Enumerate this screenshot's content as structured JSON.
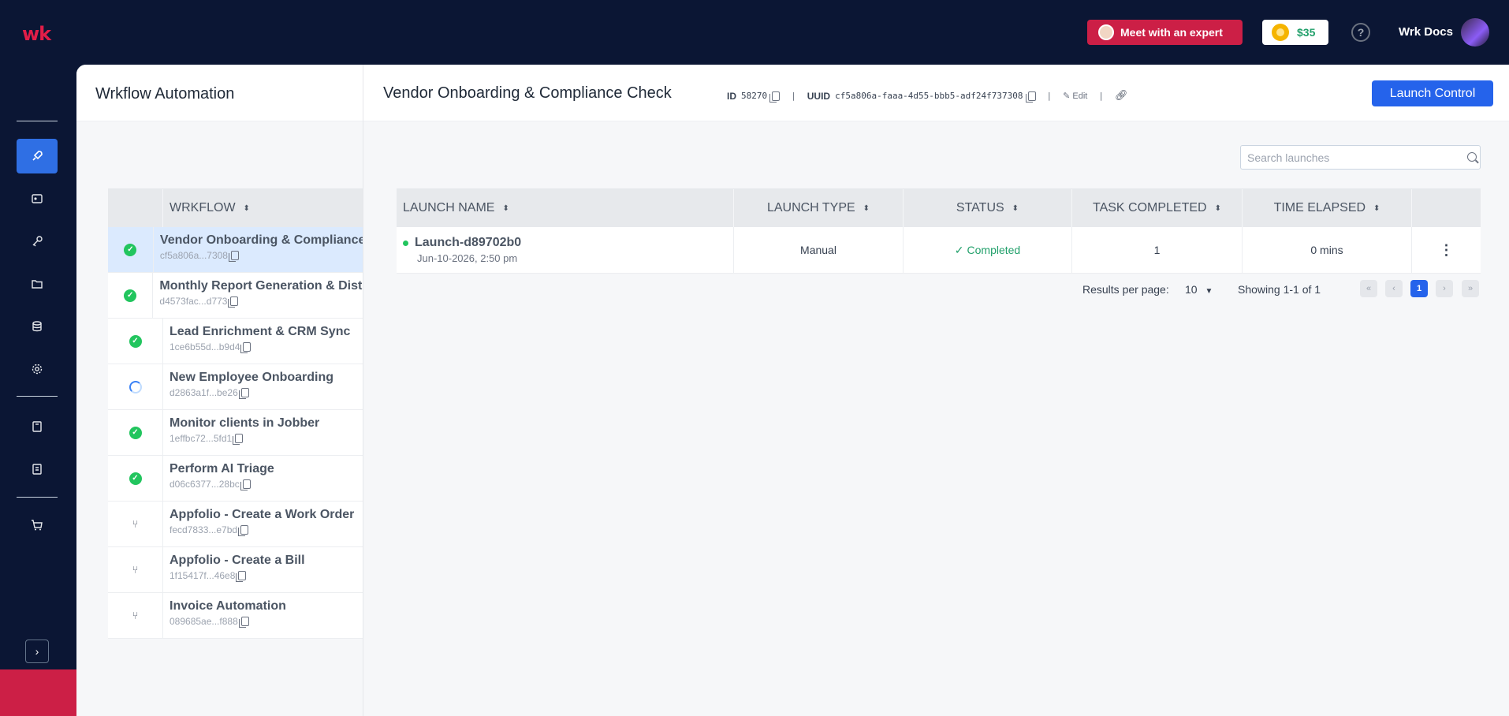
{
  "topbar": {
    "logo": "wk",
    "expert_button": "Meet with an expert",
    "credits": "$35",
    "help": "?",
    "username": "Wrk Docs"
  },
  "rail": {
    "icons": [
      "rocket-icon",
      "id-card-icon",
      "key-icon",
      "folder-icon",
      "database-icon",
      "gear-icon",
      "book-icon",
      "report-icon",
      "cart-icon"
    ],
    "expand": "›"
  },
  "workflow_panel": {
    "title": "Wrkflow Automation",
    "column_header": "WRKFLOW",
    "items": [
      {
        "name": "Vendor Onboarding & Compliance Check",
        "id": "cf5a806a...7308",
        "status": "completed"
      },
      {
        "name": "Monthly Report Generation & Distribution",
        "id": "d4573fac...d773",
        "status": "completed"
      },
      {
        "name": "Lead Enrichment & CRM Sync",
        "id": "1ce6b55d...b9d4",
        "status": "completed"
      },
      {
        "name": "New Employee Onboarding",
        "id": "d2863a1f...be26",
        "status": "running"
      },
      {
        "name": "Monitor clients in Jobber",
        "id": "1effbc72...5fd1",
        "status": "completed"
      },
      {
        "name": "Perform AI Triage",
        "id": "d06c6377...28bc",
        "status": "completed"
      },
      {
        "name": "Appfolio - Create a Work Order",
        "id": "fecd7833...e7bd",
        "status": "draft"
      },
      {
        "name": "Appfolio - Create a Bill",
        "id": "1f15417f...46e8",
        "status": "draft"
      },
      {
        "name": "Invoice Automation",
        "id": "089685ae...f888",
        "status": "draft"
      }
    ]
  },
  "main": {
    "title": "Vendor Onboarding & Compliance Check",
    "id_label": "ID",
    "id_value": "58270",
    "uuid_label": "UUID",
    "uuid_value": "cf5a806a-faaa-4d55-bbb5-adf24f737308",
    "edit_label": "Edit",
    "launch_button": "Launch Control",
    "search_placeholder": "Search launches",
    "columns": [
      "LAUNCH NAME",
      "LAUNCH TYPE",
      "STATUS",
      "TASK COMPLETED",
      "TIME ELAPSED"
    ],
    "rows": [
      {
        "name": "Launch-d89702b0",
        "date": "Jun-10-2026, 2:50 pm",
        "type": "Manual",
        "status": "Completed",
        "tasks": "1",
        "elapsed": "0 mins"
      }
    ],
    "pagination": {
      "results_label": "Results per page:",
      "per_page": "10",
      "showing": "Showing 1-1 of 1",
      "current_page": "1"
    }
  }
}
